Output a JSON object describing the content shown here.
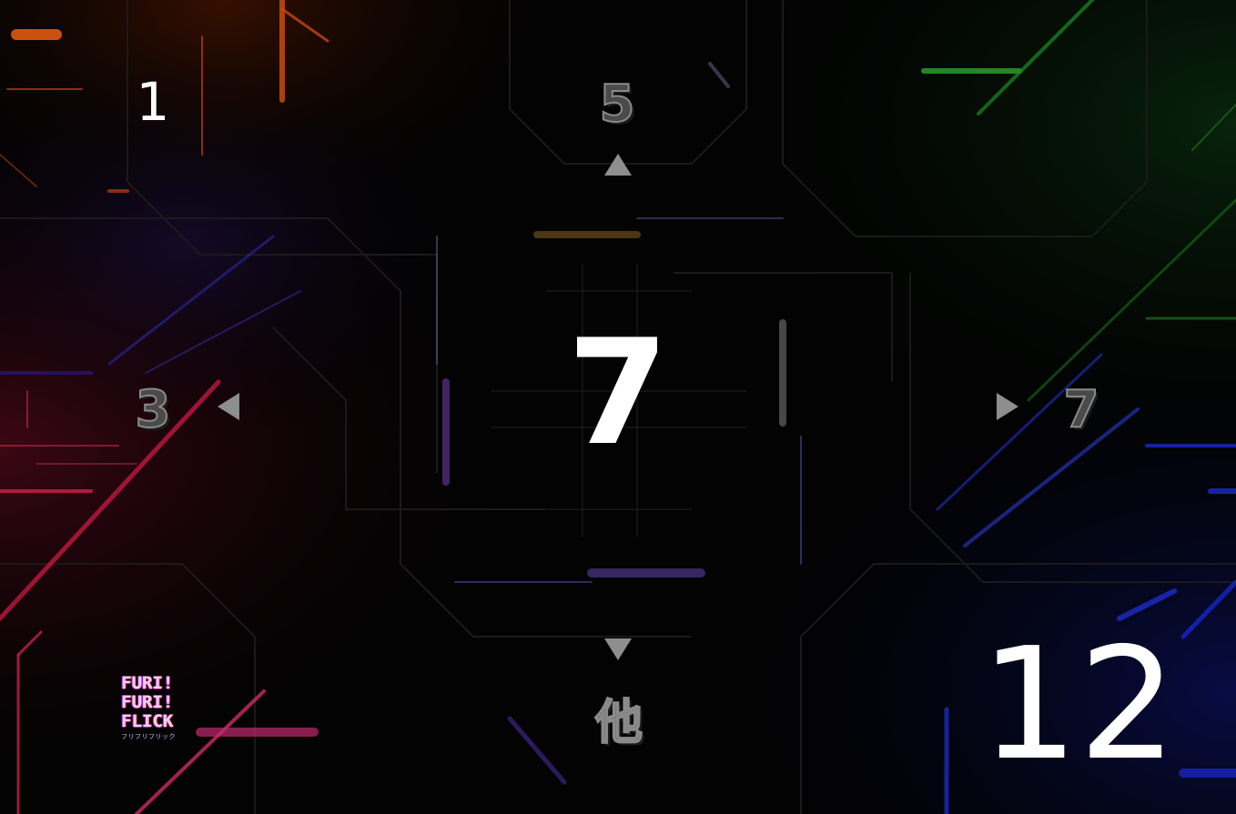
{
  "game": {
    "round_label": "1",
    "center_number": "7",
    "options": {
      "up": "5",
      "left": "3",
      "right": "7",
      "down": "他"
    },
    "counter": "12"
  },
  "logo": {
    "lines": [
      "FURI!",
      "FURI!",
      "FLICK"
    ],
    "subtitle": "フリフリフリック",
    "colors": {
      "primary": "#a020f0",
      "secondary": "#ff6a3d"
    }
  },
  "icons": {
    "up": "triangle-up-icon",
    "down": "triangle-down-icon",
    "left": "triangle-left-icon",
    "right": "triangle-right-icon"
  },
  "colors": {
    "background": "#000000",
    "accent_red": "#d0204a",
    "accent_green": "#2aa02a",
    "accent_blue": "#2030e0",
    "accent_orange": "#e05010"
  }
}
